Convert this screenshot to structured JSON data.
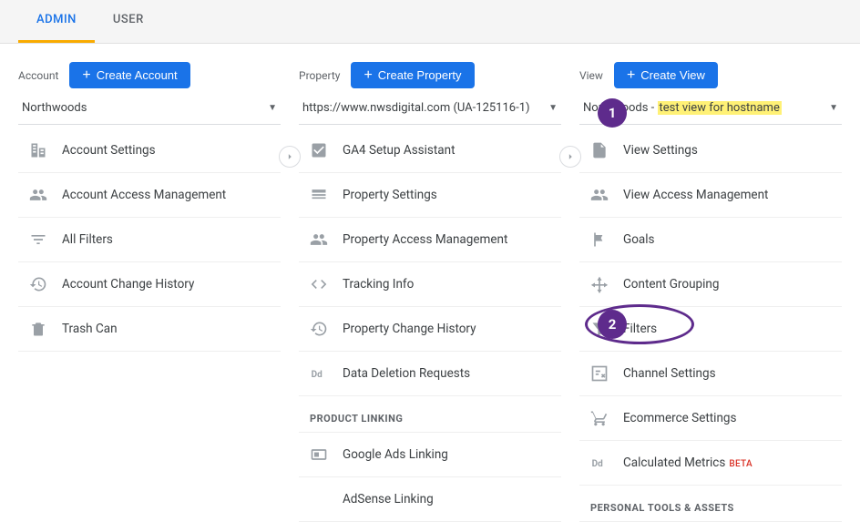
{
  "tabs": {
    "admin": "ADMIN",
    "user": "USER"
  },
  "annotations": {
    "one": "1",
    "two": "2"
  },
  "account": {
    "label": "Account",
    "create": "Create Account",
    "selected": "Northwoods",
    "items": [
      {
        "label": "Account Settings"
      },
      {
        "label": "Account Access Management"
      },
      {
        "label": "All Filters"
      },
      {
        "label": "Account Change History"
      },
      {
        "label": "Trash Can"
      }
    ]
  },
  "property": {
    "label": "Property",
    "create": "Create Property",
    "selected": "https://www.nwsdigital.com (UA-125116-1)",
    "items": [
      {
        "label": "GA4 Setup Assistant"
      },
      {
        "label": "Property Settings"
      },
      {
        "label": "Property Access Management"
      },
      {
        "label": "Tracking Info"
      },
      {
        "label": "Property Change History"
      },
      {
        "label": "Data Deletion Requests"
      }
    ],
    "section1": "PRODUCT LINKING",
    "linking": [
      {
        "label": "Google Ads Linking"
      },
      {
        "label": "AdSense Linking"
      }
    ]
  },
  "view": {
    "label": "View",
    "create": "Create View",
    "selected_prefix": "Northwoods - ",
    "selected_highlight": "test view for hostname",
    "items": [
      {
        "label": "View Settings"
      },
      {
        "label": "View Access Management"
      },
      {
        "label": "Goals"
      },
      {
        "label": "Content Grouping"
      },
      {
        "label": "Filters"
      },
      {
        "label": "Channel Settings"
      },
      {
        "label": "Ecommerce Settings"
      },
      {
        "label": "Calculated Metrics",
        "beta": "BETA"
      }
    ],
    "section1": "PERSONAL TOOLS & ASSETS"
  }
}
